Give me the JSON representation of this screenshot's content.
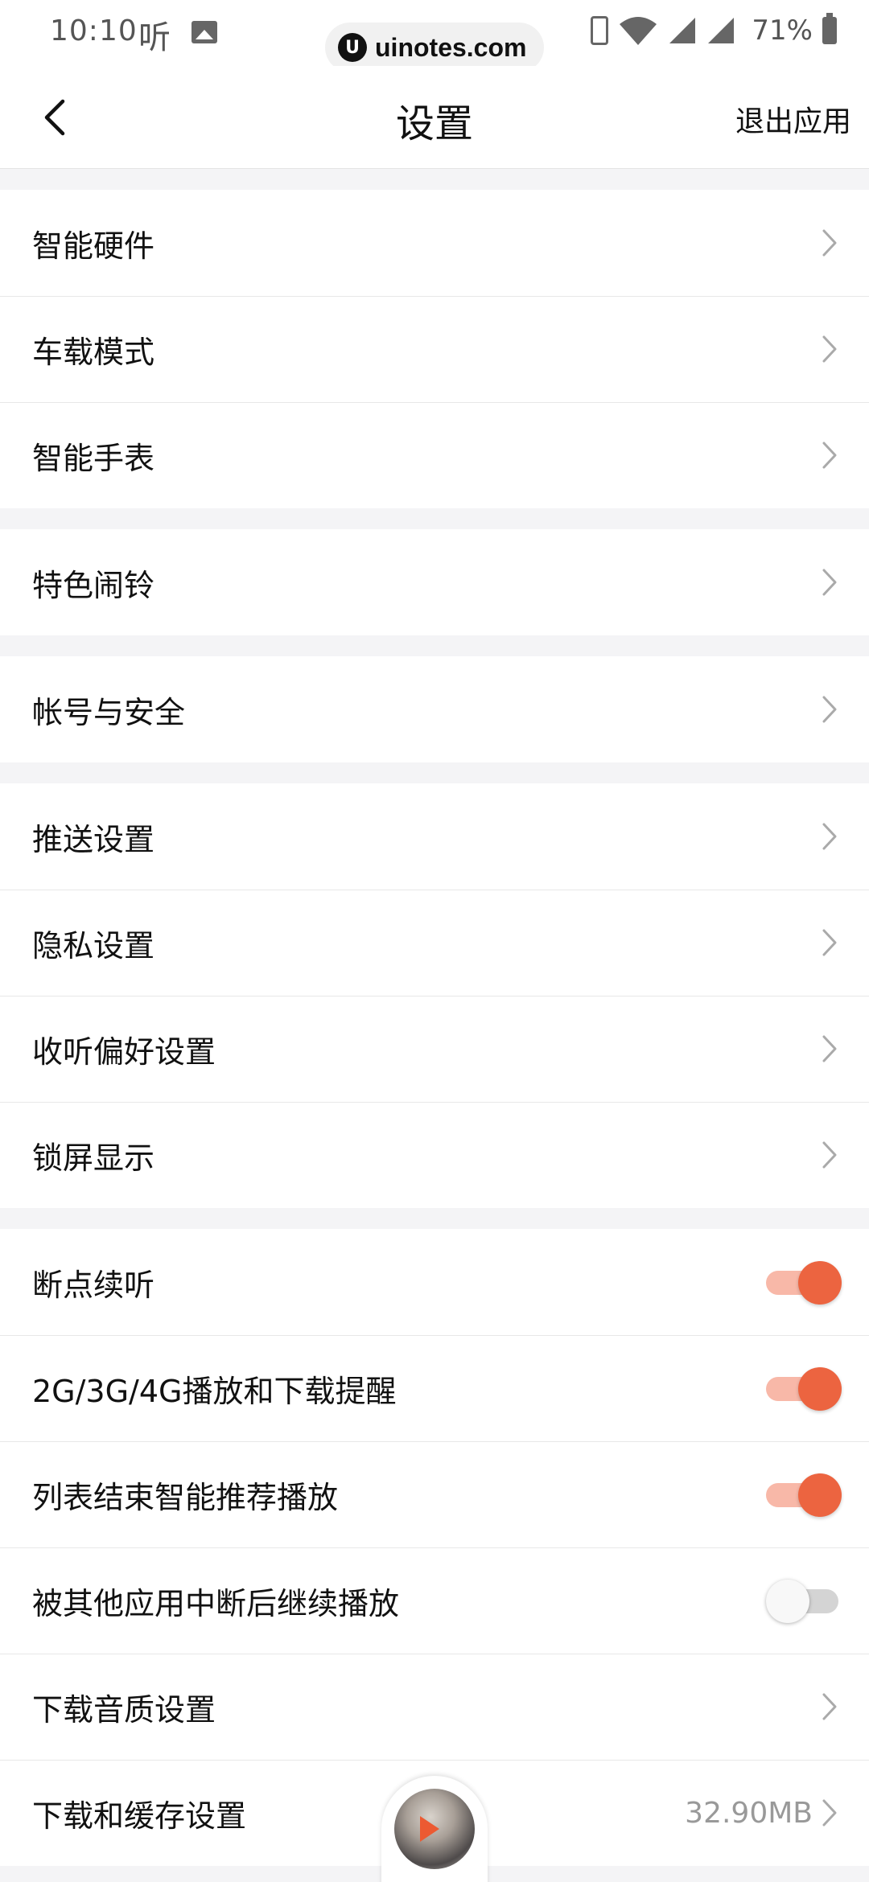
{
  "status_bar": {
    "time": "10:10",
    "app_glyph": "听",
    "url": "uinotes.com",
    "battery": "71%"
  },
  "header": {
    "title": "设置",
    "exit_label": "退出应用"
  },
  "groups": [
    {
      "rows": [
        {
          "label": "智能硬件",
          "type": "nav"
        },
        {
          "label": "车载模式",
          "type": "nav"
        },
        {
          "label": "智能手表",
          "type": "nav"
        }
      ]
    },
    {
      "rows": [
        {
          "label": "特色闹铃",
          "type": "nav"
        }
      ]
    },
    {
      "rows": [
        {
          "label": "帐号与安全",
          "type": "nav"
        }
      ]
    },
    {
      "rows": [
        {
          "label": "推送设置",
          "type": "nav"
        },
        {
          "label": "隐私设置",
          "type": "nav"
        },
        {
          "label": "收听偏好设置",
          "type": "nav"
        },
        {
          "label": "锁屏显示",
          "type": "nav"
        }
      ]
    },
    {
      "rows": [
        {
          "label": "断点续听",
          "type": "toggle",
          "on": true
        },
        {
          "label": "2G/3G/4G播放和下载提醒",
          "type": "toggle",
          "on": true
        },
        {
          "label": "列表结束智能推荐播放",
          "type": "toggle",
          "on": true
        },
        {
          "label": "被其他应用中断后继续播放",
          "type": "toggle",
          "on": false
        },
        {
          "label": "下载音质设置",
          "type": "nav"
        },
        {
          "label": "下载和缓存设置",
          "type": "nav",
          "value": "32.90MB"
        }
      ]
    }
  ],
  "colors": {
    "accent": "#ec6440",
    "accent_track": "#f8b8a8",
    "page_bg": "#f4f4f6"
  }
}
